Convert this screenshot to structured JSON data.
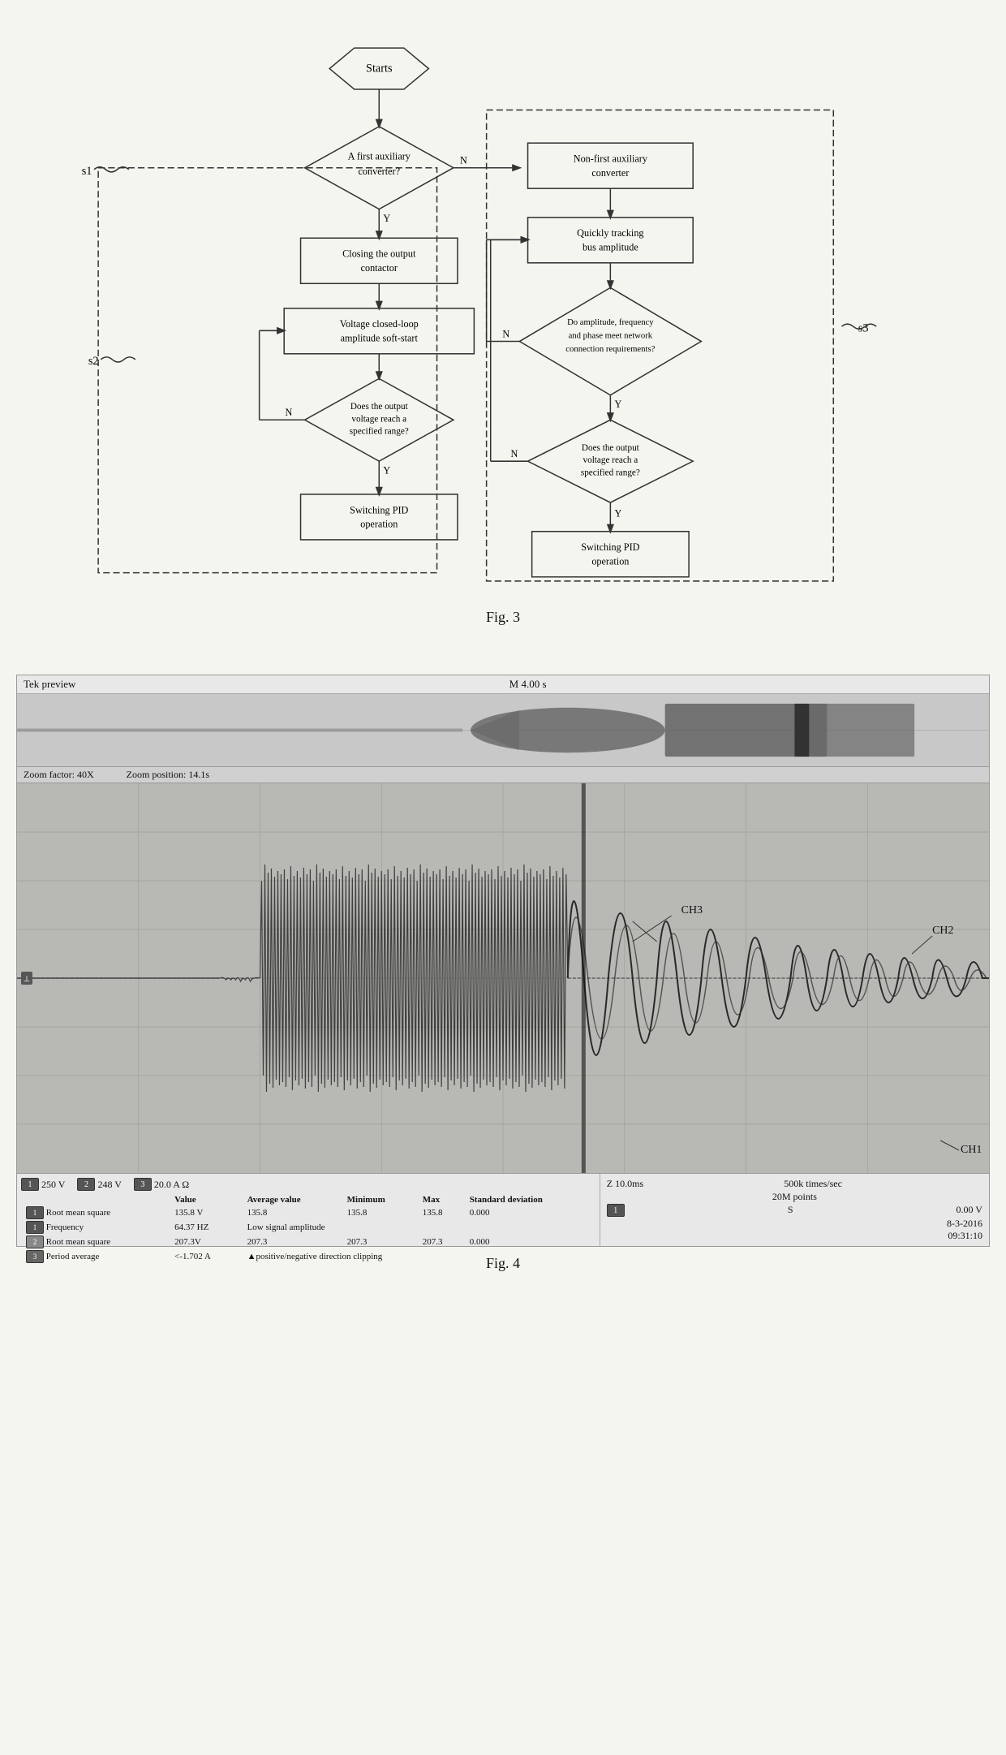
{
  "fig3": {
    "label": "Fig. 3",
    "nodes": {
      "starts": "Starts",
      "first_aux_q": "A first auxiliary converter?",
      "non_first": "Non-first auxiliary converter",
      "closing_output": "Closing the output contactor",
      "voltage_softstart": "Voltage closed-loop amplitude soft-start",
      "output_voltage_q1": "Does the output voltage reach a specified range?",
      "switching_pid1": "Switching PID operation",
      "quickly_tracking": "Quickly tracking bus amplitude",
      "amplitude_freq_q": "Do amplitude, frequency and phase meet network connection requirements?",
      "output_voltage_q2": "Does the output voltage reach a specified range?",
      "switching_pid2": "Switching PID operation"
    },
    "labels": {
      "s1": "s1",
      "s2": "s2",
      "s3": "s3",
      "n1": "N",
      "y1": "Y",
      "n2": "N",
      "y2": "Y",
      "n3": "N",
      "y3": "Y",
      "n4": "N",
      "y4": "Y"
    }
  },
  "fig4": {
    "label": "Fig. 4",
    "title": "Tek preview",
    "time_marker": "M 4.00 s",
    "zoom_factor": "Zoom factor: 40X",
    "zoom_position": "Zoom position: 14.1s",
    "channels": {
      "ch1_label": "CH1",
      "ch2_label": "CH2",
      "ch3_label": "CH3"
    },
    "bottom_left": {
      "ch1_indicator": "250 V",
      "ch2_indicator": "248 V",
      "ch3_indicator": "20.0 A Ω",
      "stats_headers": [
        "",
        "Value",
        "Average value",
        "Minimum",
        "Max",
        "Standard deviation"
      ],
      "stats_rows": [
        [
          "Root mean square",
          "135.8 V",
          "135.8",
          "135.8",
          "135.8",
          "0.000"
        ],
        [
          "Frequency",
          "64.37 HZ",
          "Low signal amplitude",
          "",
          "",
          ""
        ],
        [
          "Root mean square",
          "207.3V",
          "207.3",
          "207.3",
          "207.3",
          "0.000"
        ],
        [
          "Period average",
          "<-1.702 A",
          "▲positive/negative direction clipping",
          "",
          "",
          ""
        ]
      ]
    },
    "bottom_right": {
      "time_div": "Z 10.0ms",
      "sample_rate": "500k times/sec",
      "points": "20M points",
      "ch_num": "1",
      "volts": "S",
      "zero_val": "0.00 V",
      "date": "8-3-2016",
      "time": "09:31:10"
    }
  }
}
